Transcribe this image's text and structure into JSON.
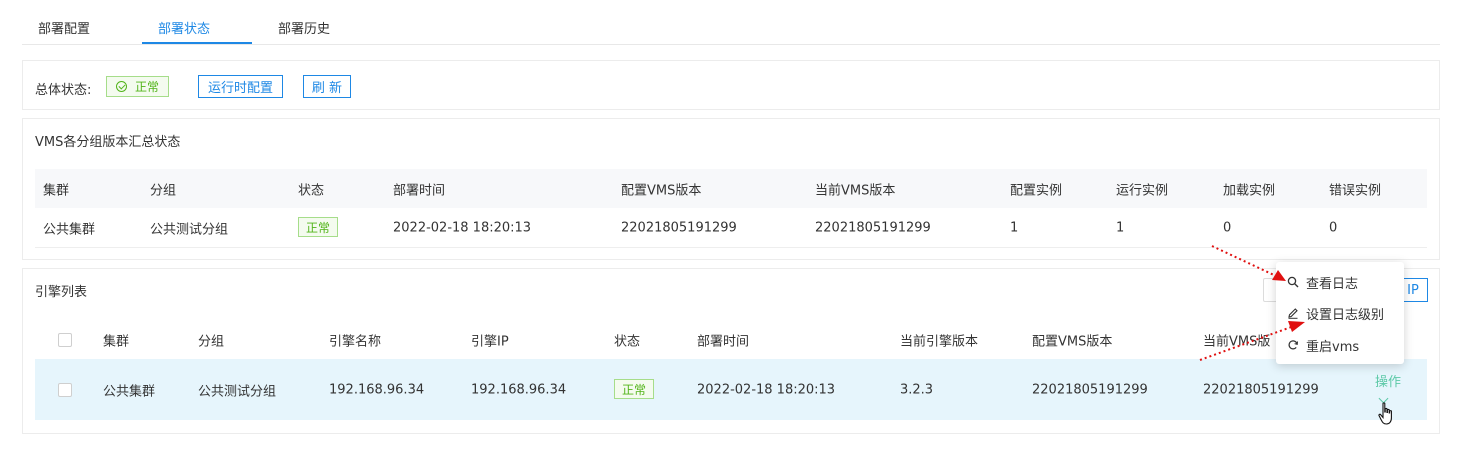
{
  "tabs": [
    {
      "label": "部署配置"
    },
    {
      "label": "部署状态"
    },
    {
      "label": "部署历史"
    }
  ],
  "overall": {
    "label": "总体状态:",
    "status": "正常",
    "runtime_config_button": "运行时配置",
    "refresh_button": "刷 新"
  },
  "summary": {
    "title": "VMS各分组版本汇总状态",
    "headers": [
      "集群",
      "分组",
      "状态",
      "部署时间",
      "配置VMS版本",
      "当前VMS版本",
      "配置实例",
      "运行实例",
      "加载实例",
      "错误实例"
    ],
    "rows": [
      {
        "cluster": "公共集群",
        "group": "公共测试分组",
        "status": "正常",
        "deploy_time": "2022-02-18 18:20:13",
        "config_vms": "22021805191299",
        "current_vms": "22021805191299",
        "config_inst": "1",
        "run_inst": "1",
        "load_inst": "0",
        "err_inst": "0"
      }
    ]
  },
  "engines": {
    "title": "引擎列表",
    "toolbar_button_partial": "IP",
    "headers": [
      "集群",
      "分组",
      "引擎名称",
      "引擎IP",
      "状态",
      "部署时间",
      "当前引擎版本",
      "配置VMS版本",
      "当前VMS版"
    ],
    "rows": [
      {
        "cluster": "公共集群",
        "group": "公共测试分组",
        "name": "192.168.96.34",
        "ip": "192.168.96.34",
        "status": "正常",
        "deploy_time": "2022-02-18 18:20:13",
        "engine_version": "3.2.3",
        "config_vms": "22021805191299",
        "current_vms": "22021805191299",
        "action": "操作"
      }
    ]
  },
  "dropdown": {
    "items": [
      {
        "label": "查看日志",
        "icon": "search-icon"
      },
      {
        "label": "设置日志级别",
        "icon": "edit-icon"
      },
      {
        "label": "重启vms",
        "icon": "refresh-icon"
      }
    ]
  },
  "colors": {
    "accent": "#1e88e5",
    "success": "#52b41a",
    "action": "#5cc9a7",
    "highlight_row": "#e6f5fc",
    "annotation_arrow": "#e01010"
  }
}
